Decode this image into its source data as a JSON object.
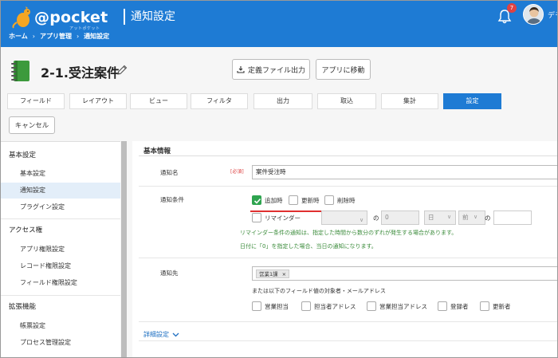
{
  "header": {
    "logo_text": "@pocket",
    "logo_sub": "アットポケット",
    "title": "通知設定",
    "notification_count": "7",
    "user_name": "デモ"
  },
  "breadcrumb": [
    "ホーム",
    "アプリ管理",
    "通知設定"
  ],
  "app": {
    "title": "2-1.受注案件",
    "export_button": "定義ファイル出力",
    "goto_button": "アプリに移動"
  },
  "tabs": [
    {
      "label": "フィールド",
      "active": false
    },
    {
      "label": "レイアウト",
      "active": false
    },
    {
      "label": "ビュー",
      "active": false
    },
    {
      "label": "フィルタ",
      "active": false
    },
    {
      "label": "出力",
      "active": false
    },
    {
      "label": "取込",
      "active": false
    },
    {
      "label": "集計",
      "active": false
    },
    {
      "label": "設定",
      "active": true
    }
  ],
  "cancel_button": "キャンセル",
  "sidebar": {
    "groups": [
      {
        "heading": "基本設定",
        "items": [
          "基本設定",
          "通知設定",
          "プラグイン設定"
        ]
      },
      {
        "heading": "アクセス権",
        "items": [
          "アプリ権限設定",
          "レコード権限設定",
          "フィールド権限設定"
        ]
      },
      {
        "heading": "拡張機能",
        "items": [
          "帳票設定",
          "プロセス管理設定"
        ]
      }
    ],
    "active_item": "通知設定"
  },
  "form": {
    "section_title": "基本情報",
    "name_label": "通知名",
    "required_mark": "[必須]",
    "name_value": "案件受注時",
    "condition_label": "通知条件",
    "conditions": [
      {
        "label": "追加時",
        "checked": true
      },
      {
        "label": "更新時",
        "checked": false
      },
      {
        "label": "削除時",
        "checked": false
      }
    ],
    "reminder_label": "リマインダー",
    "reminder_no1": "の",
    "reminder_days": "0",
    "reminder_unit": "日",
    "reminder_when": "前",
    "reminder_no2": "の",
    "note1": "リマインダー条件の通知は、指定した時間から数分のずれが発生する場合があります。",
    "note2": "日付に「0」を指定した場合、当日の通知になります。",
    "recipient_label": "通知先",
    "recipient_tag": "営業1課",
    "recipient_tag_remove": "×",
    "recipient_or": "または以下のフィールド値の対象者・メールアドレス",
    "recipient_fields": [
      "営業担当",
      "担当者アドレス",
      "営業担当アドレス",
      "登録者",
      "更新者"
    ],
    "advanced_label": "詳細設定"
  }
}
